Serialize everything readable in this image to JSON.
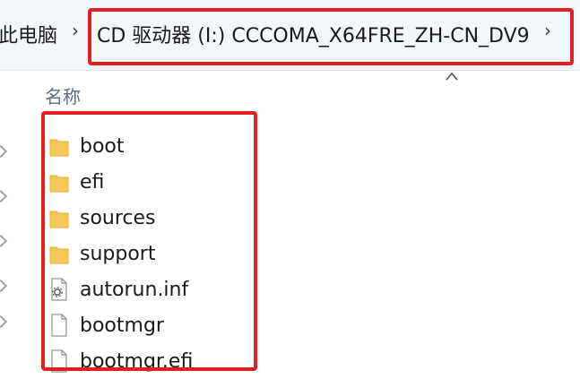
{
  "addressbar": {
    "root_label": "此电脑",
    "separator": "›",
    "current_location": "CD 驱动器 (I:) CCCOMA_X64FRE_ZH-CN_DV9",
    "highlight_color": "#e02020"
  },
  "list": {
    "name_column_header": "名称",
    "items": [
      {
        "name": "boot",
        "type": "folder"
      },
      {
        "name": "efi",
        "type": "folder"
      },
      {
        "name": "sources",
        "type": "folder"
      },
      {
        "name": "support",
        "type": "folder"
      },
      {
        "name": "autorun.inf",
        "type": "settings-file"
      },
      {
        "name": "bootmgr",
        "type": "file"
      },
      {
        "name": "bootmgr.efi",
        "type": "file"
      }
    ]
  },
  "colors": {
    "folder": "#f6c858",
    "folder_dark": "#e8ae2e",
    "file_border": "#7b7b7b"
  }
}
